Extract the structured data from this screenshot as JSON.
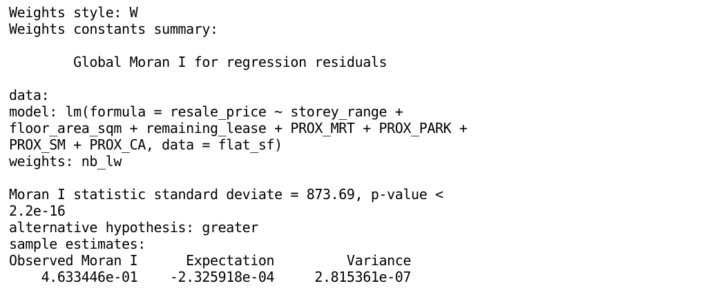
{
  "output": {
    "lines": [
      "Weights style: W",
      "Weights constants summary:",
      "",
      "        Global Moran I for regression residuals",
      "",
      "data:",
      "model: lm(formula = resale_price ~ storey_range +",
      "floor_area_sqm + remaining_lease + PROX_MRT + PROX_PARK +",
      "PROX_SM + PROX_CA, data = flat_sf)",
      "weights: nb_lw",
      "",
      "Moran I statistic standard deviate = 873.69, p-value <",
      "2.2e-16",
      "alternative hypothesis: greater",
      "sample estimates:",
      "Observed Moran I      Expectation         Variance",
      "    4.633446e-01    -2.325918e-04     2.815361e-07"
    ]
  }
}
